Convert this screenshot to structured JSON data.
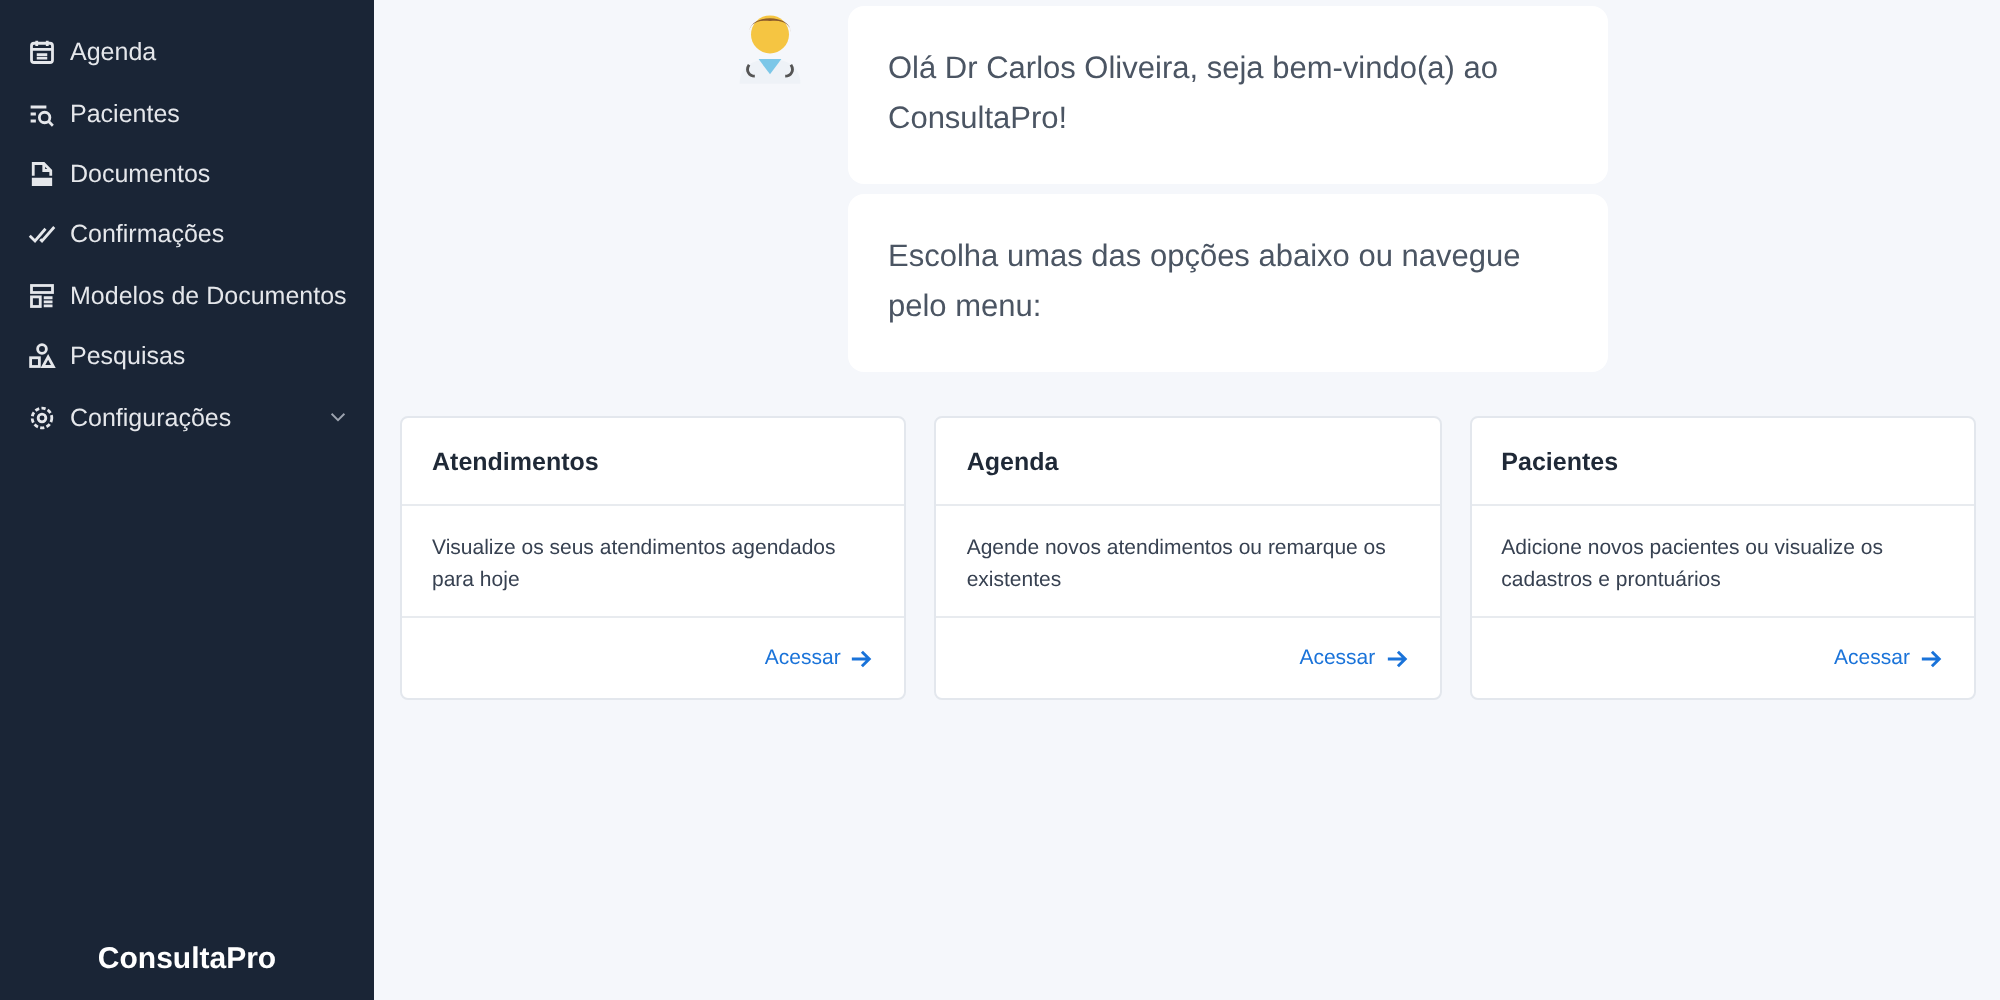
{
  "sidebar": {
    "items": [
      {
        "label": "Agenda"
      },
      {
        "label": "Pacientes"
      },
      {
        "label": "Documentos"
      },
      {
        "label": "Confirmações"
      },
      {
        "label": "Modelos de Documentos"
      },
      {
        "label": "Pesquisas"
      },
      {
        "label": "Configurações",
        "expanded": false
      }
    ],
    "brand": "ConsultaPro"
  },
  "chat": {
    "messages": [
      "Olá Dr Carlos Oliveira, seja bem-vindo(a) ao ConsultaPro!",
      "Escolha umas das opções abaixo ou navegue pelo menu:"
    ]
  },
  "cards": [
    {
      "title": "Atendimentos",
      "text": "Visualize os seus atendimentos agendados para hoje",
      "link": "Acessar"
    },
    {
      "title": "Agenda",
      "text": "Agende novos atendimentos ou remarque os existentes",
      "link": "Acessar"
    },
    {
      "title": "Pacientes",
      "text": "Adicione novos pacientes ou visualize os cadastros e prontuários",
      "link": "Acessar"
    }
  ]
}
